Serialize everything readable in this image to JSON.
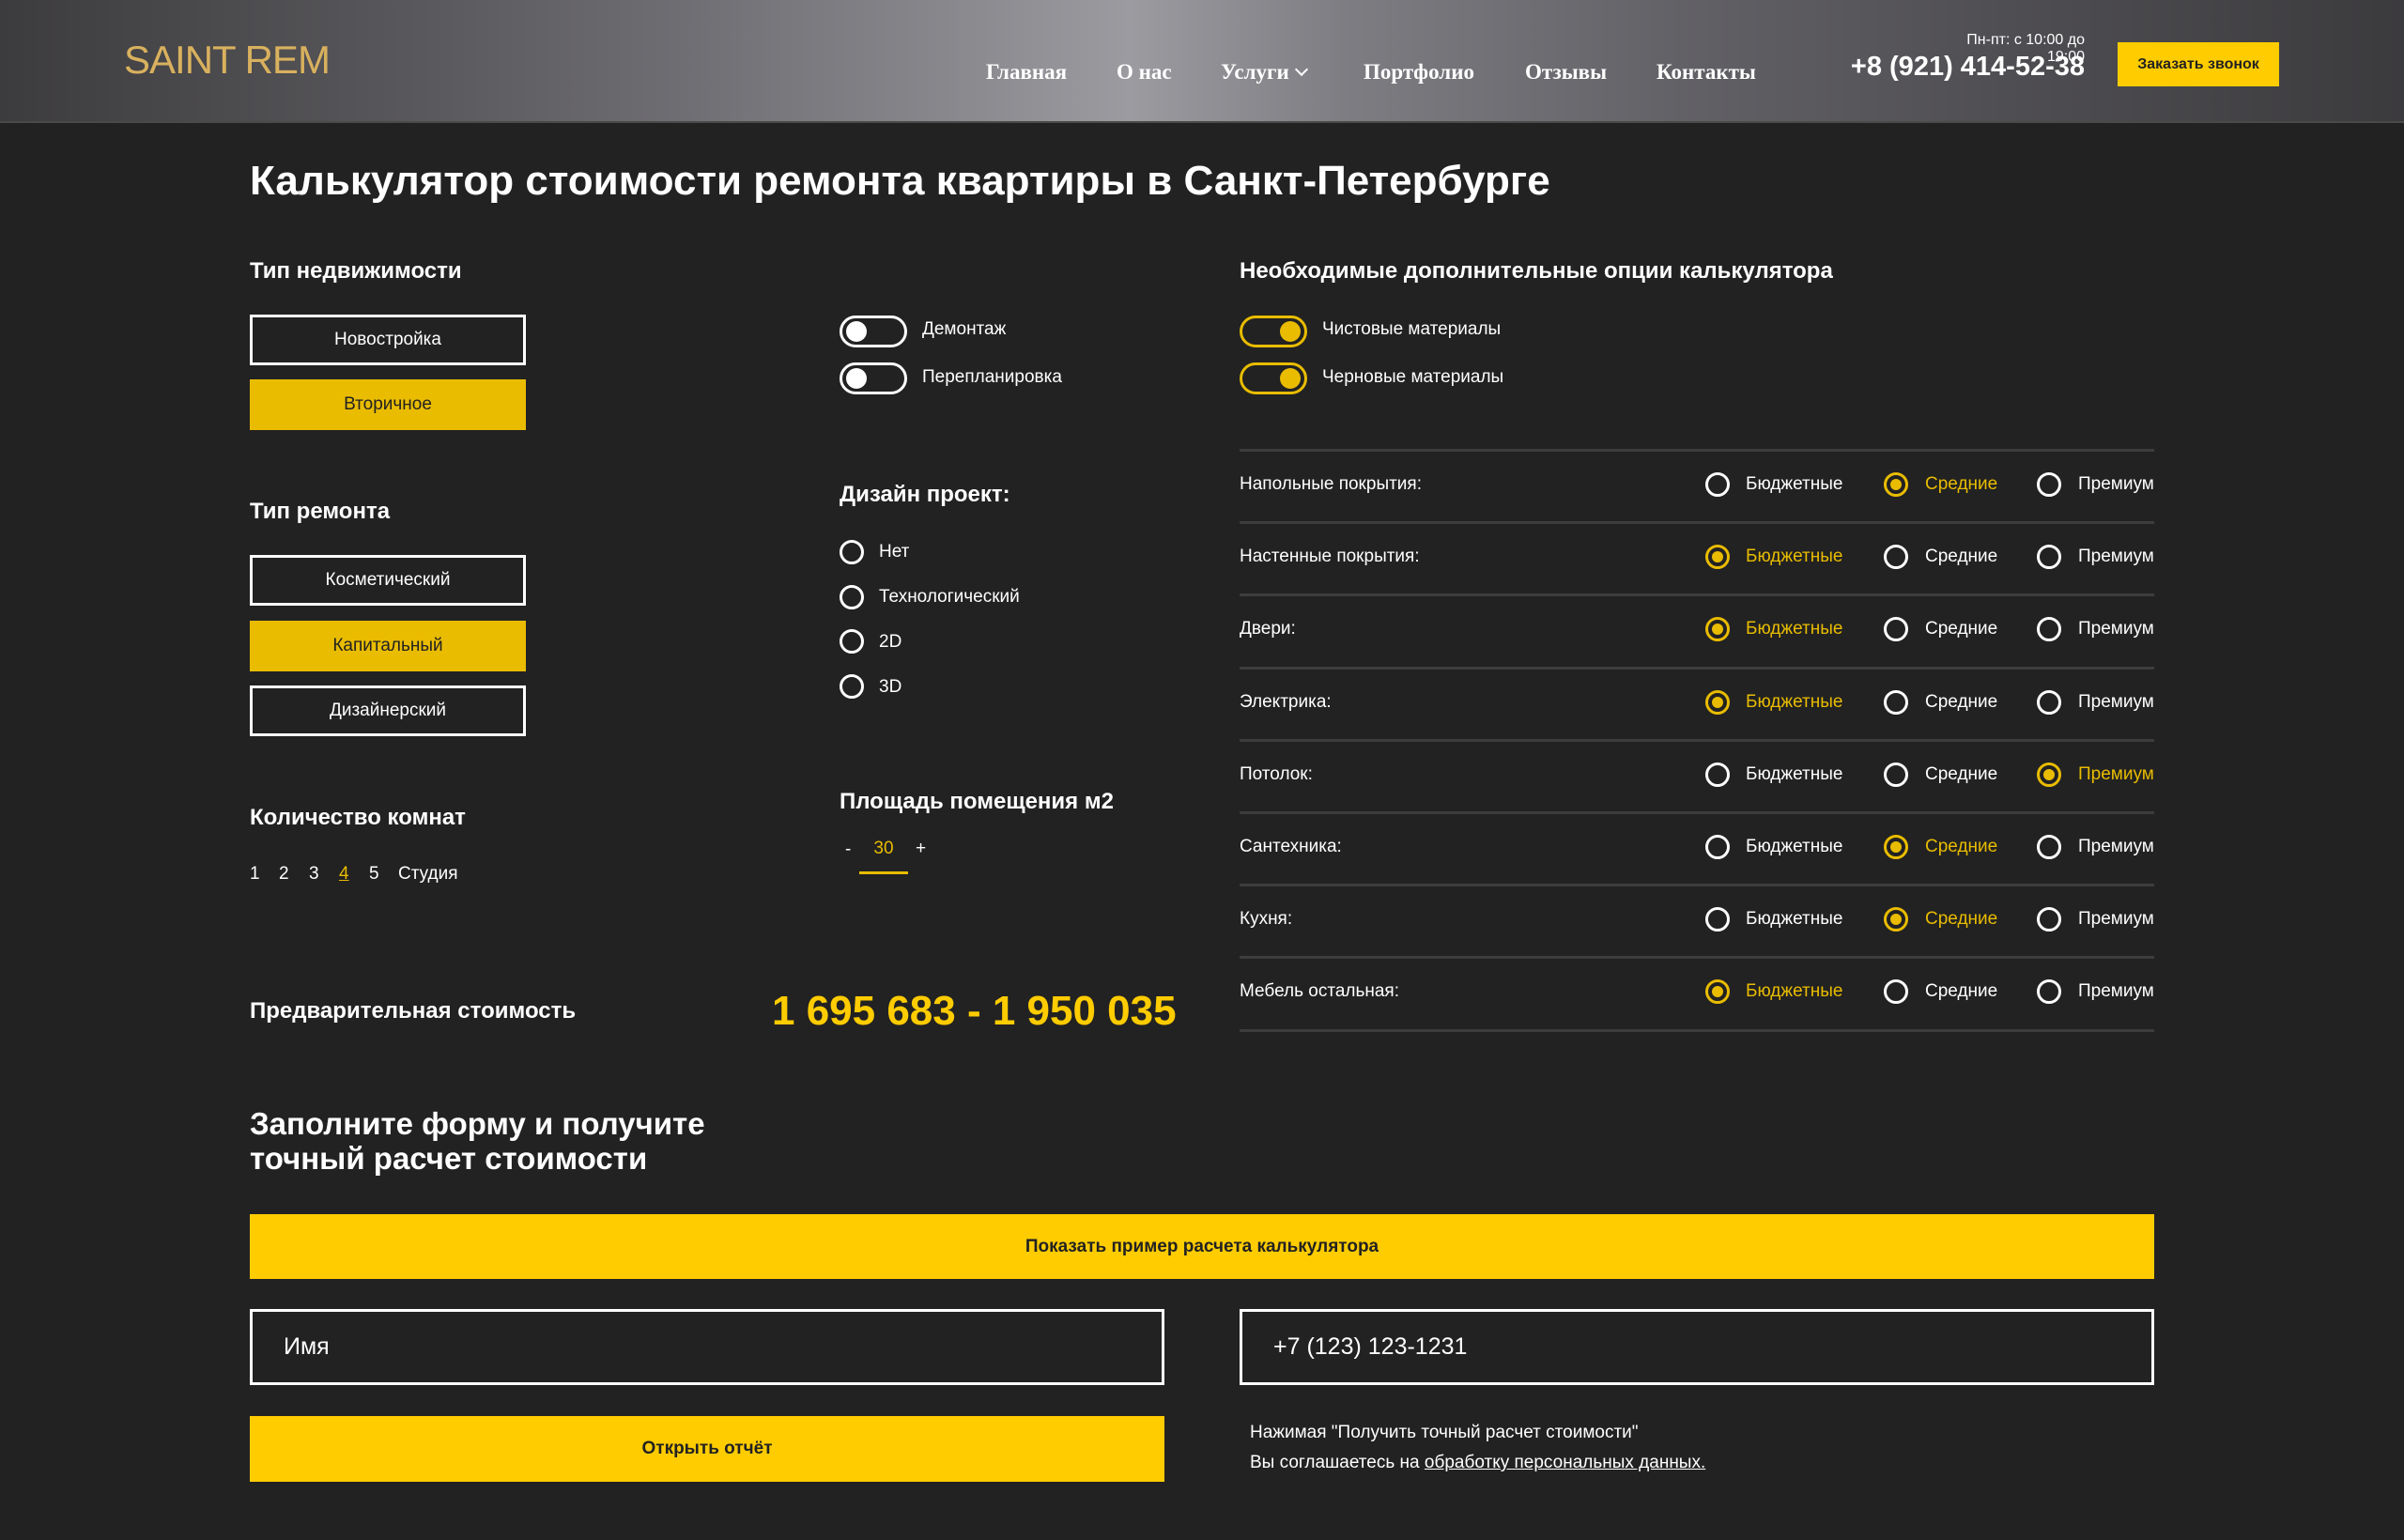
{
  "header": {
    "logo": "SAINT REM",
    "nav": [
      {
        "label": "Главная"
      },
      {
        "label": "О нас"
      },
      {
        "label": "Услуги"
      },
      {
        "label": "Портфолио"
      },
      {
        "label": "Отзывы"
      },
      {
        "label": "Контакты"
      }
    ],
    "hours": "Пн-пт: с 10:00 до 19:00",
    "phone": "+8 (921) 414-52-38",
    "call_button": "Заказать звонок"
  },
  "title": "Калькулятор стоимости ремонта квартиры в Санкт-Петербурге",
  "property_type": {
    "label": "Тип недвижимости",
    "options": [
      "Новостройка",
      "Вторичное"
    ],
    "selected": "Вторичное"
  },
  "repair_type": {
    "label": "Тип ремонта",
    "options": [
      "Косметический",
      "Капитальный",
      "Дизайнерский"
    ],
    "selected": "Капитальный"
  },
  "rooms": {
    "label": "Количество комнат",
    "options": [
      "1",
      "2",
      "3",
      "4",
      "5",
      "Студия"
    ],
    "selected": "4"
  },
  "toggles_left": [
    {
      "label": "Демонтаж",
      "on": false
    },
    {
      "label": "Перепланировка",
      "on": false
    }
  ],
  "design": {
    "label": "Дизайн проект:",
    "options": [
      "Нет",
      "Технологический",
      "2D",
      "3D"
    ]
  },
  "area": {
    "label": "Площадь помещения м2",
    "minus": "-",
    "value": "30",
    "plus": "+"
  },
  "extra_options": {
    "label": "Необходимые дополнительные опции калькулятора",
    "toggles": [
      {
        "label": "Чистовые материалы",
        "on": true
      },
      {
        "label": "Черновые материалы",
        "on": true
      }
    ],
    "levels": [
      "Бюджетные",
      "Средние",
      "Премиум"
    ],
    "rows": [
      {
        "label": "Напольные покрытия:",
        "selected": "Средние"
      },
      {
        "label": "Настенные покрытия:",
        "selected": "Бюджетные"
      },
      {
        "label": "Двери:",
        "selected": "Бюджетные"
      },
      {
        "label": "Электрика:",
        "selected": "Бюджетные"
      },
      {
        "label": "Потолок:",
        "selected": "Премиум"
      },
      {
        "label": "Сантехника:",
        "selected": "Средние"
      },
      {
        "label": "Кухня:",
        "selected": "Средние"
      },
      {
        "label": "Мебель остальная:",
        "selected": "Бюджетные"
      }
    ]
  },
  "price": {
    "label": "Предварительная стоимость",
    "value": "1 695 683 - 1 950 035"
  },
  "form": {
    "title_line1": "Заполните форму и получите",
    "title_line2": "точный расчет стоимости",
    "example_button": "Показать пример расчета калькулятора",
    "name_placeholder": "Имя",
    "phone_placeholder": "+7 (123) 123-1231",
    "submit": "Открыть отчёт",
    "consent_line1": "Нажимая \"Получить точный расчет стоимости\"",
    "consent_line2": "Вы соглашаетесь на ",
    "consent_link": "обработку персональных данных."
  },
  "colors": {
    "background": "#222222",
    "accent": "#ffcc00",
    "accent_dark": "#e9bc00",
    "logo": "#d9b15e"
  }
}
